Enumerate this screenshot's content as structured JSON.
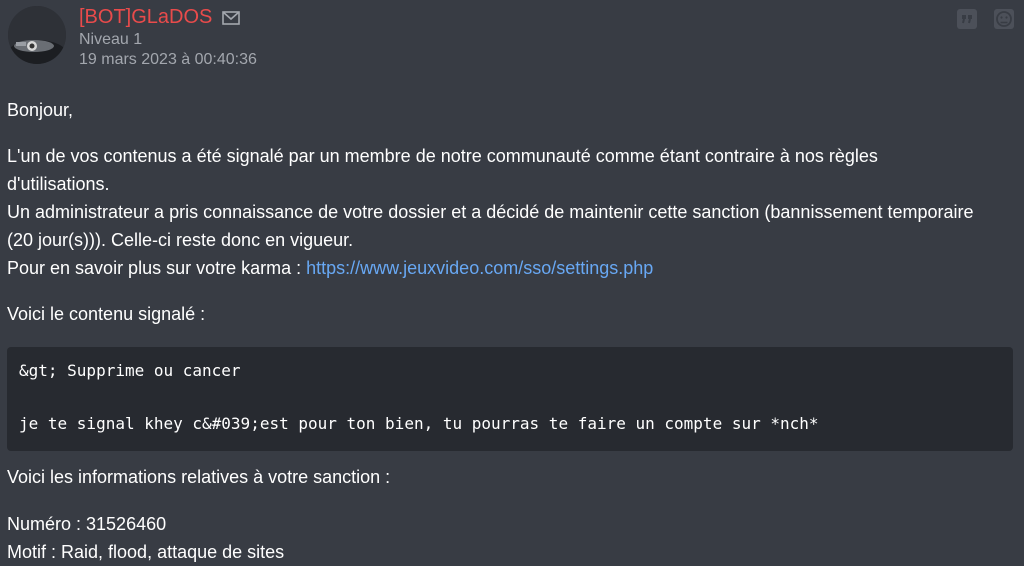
{
  "post": {
    "author": "[BOT]GLaDOS",
    "level": "Niveau 1",
    "date": "19 mars 2023 à 00:40:36",
    "icons": {
      "mail": "envelope-icon",
      "quote": "quote-icon",
      "report": "report-face-icon"
    },
    "colors": {
      "author": "#e94b4b",
      "link": "#68a8f4",
      "background": "#383c44",
      "code_background": "#272a30"
    }
  },
  "message": {
    "greeting": "Bonjour,",
    "paragraph1_line1": "L'un de vos contenus a été signalé par un membre de notre communauté comme étant contraire à nos règles",
    "paragraph1_line2": "d'utilisations.",
    "paragraph1_line3": "Un administrateur a pris connaissance de votre dossier et a décidé de maintenir cette sanction (bannissement temporaire",
    "paragraph1_line4": "(20 jour(s))). Celle-ci reste donc en vigueur.",
    "karma_prefix": "Pour en savoir plus sur votre karma : ",
    "karma_link": "https://www.jeuxvideo.com/sso/settings.php",
    "reported_intro": "Voici le contenu signalé :",
    "code_line1": "&gt; Supprime ou cancer",
    "code_line2": "je te signal khey c&#039;est pour ton bien, tu pourras te faire un compte sur *nch*",
    "sanction_intro": "Voici les informations relatives à votre sanction :",
    "number": "Numéro : 31526460",
    "reason": "Motif : Raid, flood, attaque de sites"
  }
}
